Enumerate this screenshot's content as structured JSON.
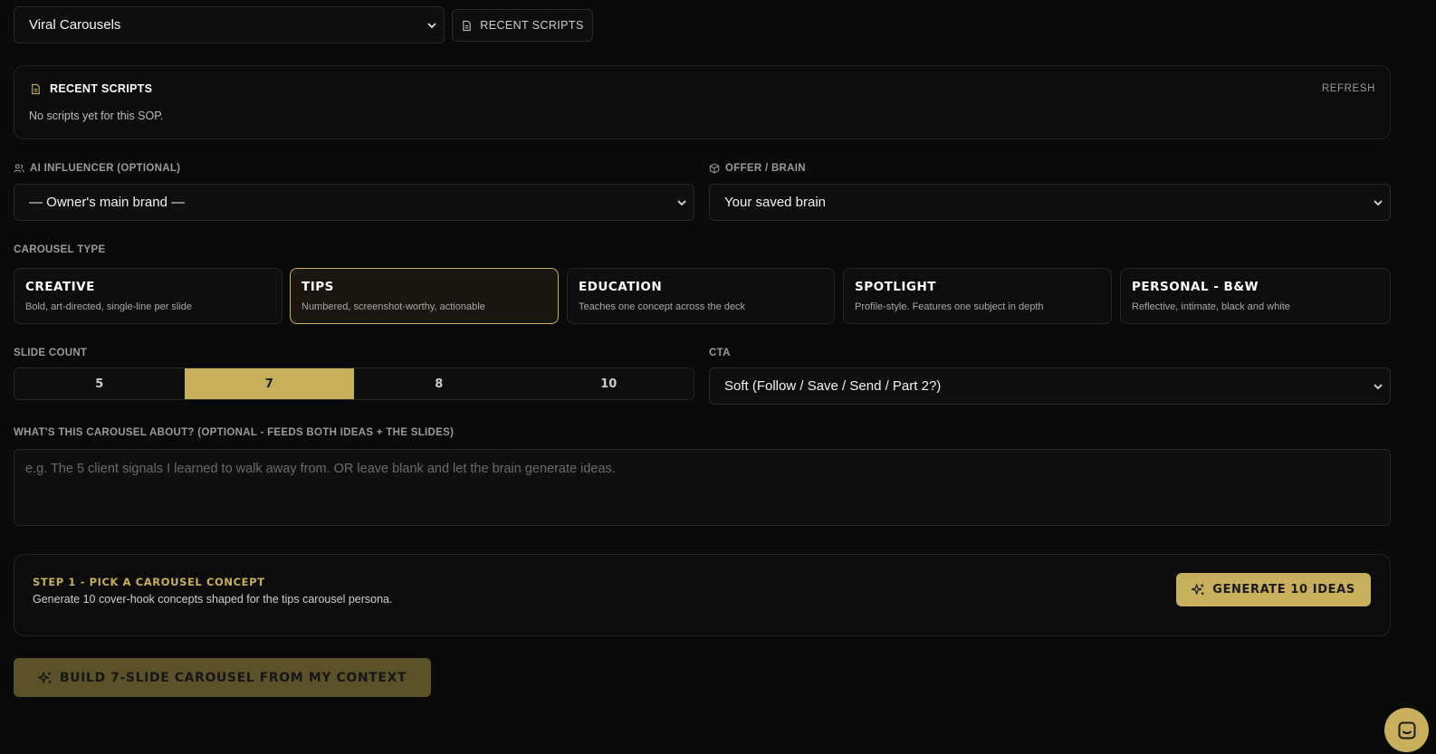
{
  "sop_select": {
    "value": "Viral Carousels"
  },
  "recent_scripts_button": {
    "label": "RECENT SCRIPTS",
    "icon": "document-icon"
  },
  "recent_panel": {
    "title": "RECENT SCRIPTS",
    "refresh_label": "REFRESH",
    "empty_text": "No scripts yet for this SOP."
  },
  "influencer": {
    "label": "AI INFLUENCER (OPTIONAL)",
    "icon": "users-icon",
    "value": "— Owner's main brand —"
  },
  "offer": {
    "label": "OFFER / BRAIN",
    "icon": "cube-icon",
    "value": "Your saved brain"
  },
  "carousel_type": {
    "label": "CAROUSEL TYPE",
    "options": [
      {
        "title": "CREATIVE",
        "desc": "Bold, art-directed, single-line per slide",
        "selected": false
      },
      {
        "title": "TIPS",
        "desc": "Numbered, screenshot-worthy, actionable",
        "selected": true
      },
      {
        "title": "EDUCATION",
        "desc": "Teaches one concept across the deck",
        "selected": false
      },
      {
        "title": "SPOTLIGHT",
        "desc": "Profile-style. Features one subject in depth",
        "selected": false
      },
      {
        "title": "PERSONAL - B&W",
        "desc": "Reflective, intimate, black and white",
        "selected": false
      }
    ]
  },
  "slide_count": {
    "label": "SLIDE COUNT",
    "options": [
      "5",
      "7",
      "8",
      "10"
    ],
    "selected": "7"
  },
  "cta": {
    "label": "CTA",
    "value": "Soft (Follow / Save / Send / Part 2?)"
  },
  "about": {
    "label": "WHAT'S THIS CAROUSEL ABOUT? (OPTIONAL - FEEDS BOTH IDEAS + THE SLIDES)",
    "placeholder": "e.g. The 5 client signals I learned to walk away from. OR leave blank and let the brain generate ideas.",
    "value": ""
  },
  "step1": {
    "title": "STEP 1 - PICK A CAROUSEL CONCEPT",
    "desc": "Generate 10 cover-hook concepts shaped for the tips carousel persona.",
    "button_label": "GENERATE 10 IDEAS"
  },
  "build_button": {
    "label": "BUILD 7-SLIDE CAROUSEL FROM MY CONTEXT",
    "disabled": true
  },
  "chat_launcher": {
    "icon": "chat-icon"
  },
  "colors": {
    "accent": "#c7af5b",
    "background": "#0a0a0a",
    "panel": "#0c0c0c",
    "border": "#242424"
  }
}
